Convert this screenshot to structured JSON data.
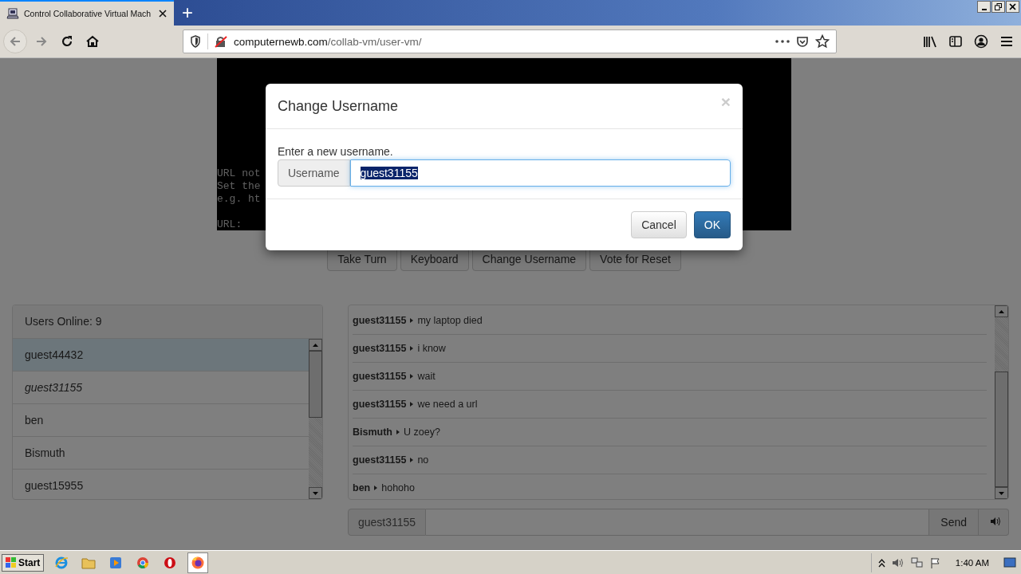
{
  "browser": {
    "tab_title": "Control Collaborative Virtual Mach",
    "new_tab": "+",
    "url_domain": "computernewb.com",
    "url_path": "/collab-vm/user-vm/"
  },
  "vm_screen": {
    "blocks": [
      [
        "URL not",
        "Set the",
        "e.g. ht"
      ],
      [
        "URL:"
      ]
    ]
  },
  "vm_buttons": [
    "Take Turn",
    "Keyboard",
    "Change Username",
    "Vote for Reset"
  ],
  "users": {
    "header": "Users Online: 9",
    "items": [
      {
        "name": "guest44432",
        "selected": true,
        "self": false
      },
      {
        "name": "guest31155",
        "selected": false,
        "self": true
      },
      {
        "name": "ben",
        "selected": false,
        "self": false
      },
      {
        "name": "Bismuth",
        "selected": false,
        "self": false
      },
      {
        "name": "guest15955",
        "selected": false,
        "self": false
      }
    ]
  },
  "chat": {
    "messages": [
      {
        "user": "guest31155",
        "text": "my laptop died"
      },
      {
        "user": "guest31155",
        "text": "i know"
      },
      {
        "user": "guest31155",
        "text": "wait"
      },
      {
        "user": "guest31155",
        "text": "we need a url"
      },
      {
        "user": "Bismuth",
        "text": "U zoey?"
      },
      {
        "user": "guest31155",
        "text": "no"
      },
      {
        "user": "ben",
        "text": "hohoho"
      }
    ],
    "username": "guest31155",
    "send_label": "Send"
  },
  "modal": {
    "title": "Change Username",
    "close": "×",
    "prompt": "Enter a new username.",
    "addon": "Username",
    "value": "guest31155",
    "value_selected": true,
    "buttons": [
      {
        "label": "Cancel",
        "kind": "default"
      },
      {
        "label": "OK",
        "kind": "primary"
      }
    ]
  },
  "taskbar": {
    "start": "Start",
    "clock": "1:40 AM"
  }
}
